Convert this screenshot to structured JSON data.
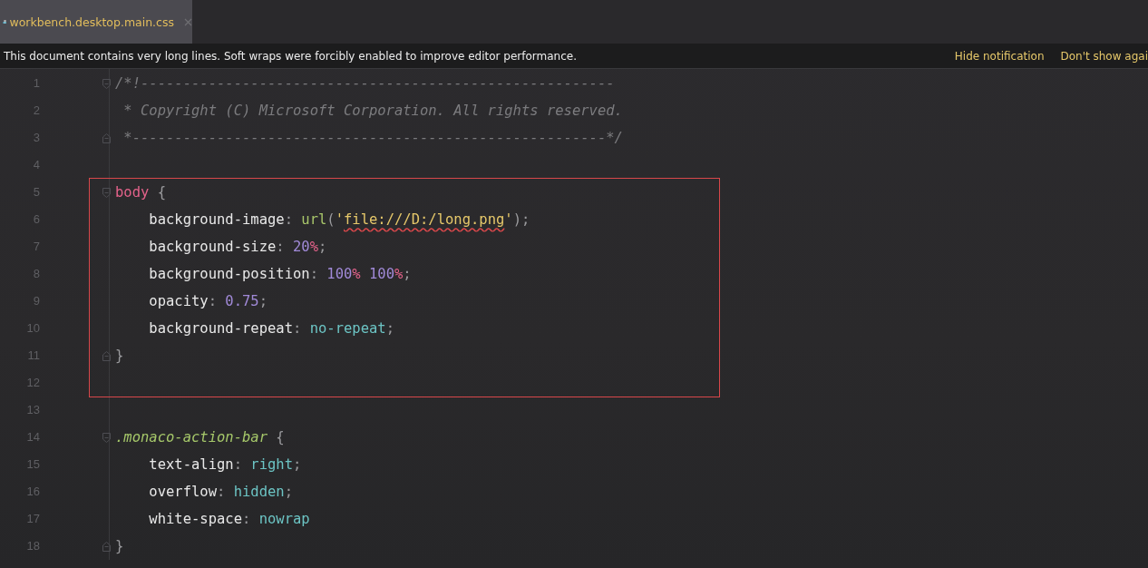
{
  "tab": {
    "title": "workbench.desktop.main.css",
    "selected": true
  },
  "notification": {
    "message": "This document contains very long lines. Soft wraps were forcibly enabled to improve editor performance.",
    "actions": [
      "Hide notification",
      "Don't show agai"
    ]
  },
  "blocks": [
    {
      "kind": "plain",
      "lines": [
        {
          "number": "1",
          "fold_start": true,
          "fold_end": false,
          "tokens": [
            {
              "kind": "comment",
              "text": "/*!--------------------------------------------------------"
            }
          ]
        },
        {
          "number": "2",
          "fold_start": false,
          "fold_end": false,
          "tokens": [
            {
              "kind": "comment",
              "text": " * Copyright (C) Microsoft Corporation. All rights reserved."
            }
          ]
        },
        {
          "number": "3",
          "fold_start": false,
          "fold_end": true,
          "tokens": [
            {
              "kind": "comment",
              "text": " *--------------------------------------------------------*/"
            }
          ]
        },
        {
          "number": "4",
          "fold_start": false,
          "fold_end": false
        }
      ]
    },
    {
      "kind": "highlighted",
      "lines": [
        {
          "number": "5",
          "fold_start": true,
          "fold_end": false,
          "tokens": [
            {
              "kind": "selector",
              "text": "body"
            },
            {
              "kind": "punct",
              "text": " {"
            }
          ]
        },
        {
          "number": "6",
          "fold_start": false,
          "fold_end": false,
          "tokens": [
            {
              "kind": "property",
              "text": "    background-image"
            },
            {
              "kind": "punct",
              "text": ": "
            },
            {
              "kind": "function",
              "text": "url"
            },
            {
              "kind": "punct",
              "text": "("
            },
            {
              "kind": "string",
              "text": "'"
            },
            {
              "kind": "string_typo",
              "text": "file:///D:/long.png"
            },
            {
              "kind": "string",
              "text": "'"
            },
            {
              "kind": "punct",
              "text": ");"
            }
          ]
        },
        {
          "number": "7",
          "fold_start": false,
          "fold_end": false,
          "tokens": [
            {
              "kind": "property",
              "text": "    background-size"
            },
            {
              "kind": "punct",
              "text": ": "
            },
            {
              "kind": "number",
              "text": "20"
            },
            {
              "kind": "unit",
              "text": "%"
            },
            {
              "kind": "punct",
              "text": ";"
            }
          ]
        },
        {
          "number": "8",
          "fold_start": false,
          "fold_end": false,
          "tokens": [
            {
              "kind": "property",
              "text": "    background-position"
            },
            {
              "kind": "punct",
              "text": ": "
            },
            {
              "kind": "number",
              "text": "100"
            },
            {
              "kind": "unit",
              "text": "%"
            },
            {
              "kind": "number",
              "text": " 100"
            },
            {
              "kind": "unit",
              "text": "%"
            },
            {
              "kind": "punct",
              "text": ";"
            }
          ]
        },
        {
          "number": "9",
          "fold_start": false,
          "fold_end": false,
          "tokens": [
            {
              "kind": "property",
              "text": "    opacity"
            },
            {
              "kind": "punct",
              "text": ": "
            },
            {
              "kind": "number",
              "text": "0.75"
            },
            {
              "kind": "punct",
              "text": ";"
            }
          ]
        },
        {
          "number": "10",
          "fold_start": false,
          "fold_end": false,
          "tokens": [
            {
              "kind": "property",
              "text": "    background-repeat"
            },
            {
              "kind": "punct",
              "text": ": "
            },
            {
              "kind": "keyword",
              "text": "no-repeat"
            },
            {
              "kind": "punct",
              "text": ";"
            }
          ]
        },
        {
          "number": "11",
          "fold_start": false,
          "fold_end": true,
          "tokens": [
            {
              "kind": "punct",
              "text": "}"
            }
          ]
        },
        {
          "number": "12",
          "fold_start": false,
          "fold_end": false
        }
      ]
    },
    {
      "kind": "plain",
      "lines": [
        {
          "number": "13",
          "fold_start": false,
          "fold_end": false
        },
        {
          "number": "14",
          "fold_start": true,
          "fold_end": false,
          "tokens": [
            {
              "kind": "class",
              "text": ".monaco-action-bar"
            },
            {
              "kind": "punct",
              "text": " {"
            }
          ]
        },
        {
          "number": "15",
          "fold_start": false,
          "fold_end": false,
          "tokens": [
            {
              "kind": "property",
              "text": "    text-align"
            },
            {
              "kind": "punct",
              "text": ": "
            },
            {
              "kind": "keyword",
              "text": "right"
            },
            {
              "kind": "punct",
              "text": ";"
            }
          ]
        },
        {
          "number": "16",
          "fold_start": false,
          "fold_end": false,
          "tokens": [
            {
              "kind": "property",
              "text": "    overflow"
            },
            {
              "kind": "punct",
              "text": ": "
            },
            {
              "kind": "keyword",
              "text": "hidden"
            },
            {
              "kind": "punct",
              "text": ";"
            }
          ]
        },
        {
          "number": "17",
          "fold_start": false,
          "fold_end": false,
          "tokens": [
            {
              "kind": "property",
              "text": "    white-space"
            },
            {
              "kind": "punct",
              "text": ": "
            },
            {
              "kind": "keyword",
              "text": "nowrap"
            }
          ]
        },
        {
          "number": "18",
          "fold_start": false,
          "fold_end": true,
          "tokens": [
            {
              "kind": "punct",
              "text": "}"
            }
          ]
        }
      ]
    }
  ]
}
